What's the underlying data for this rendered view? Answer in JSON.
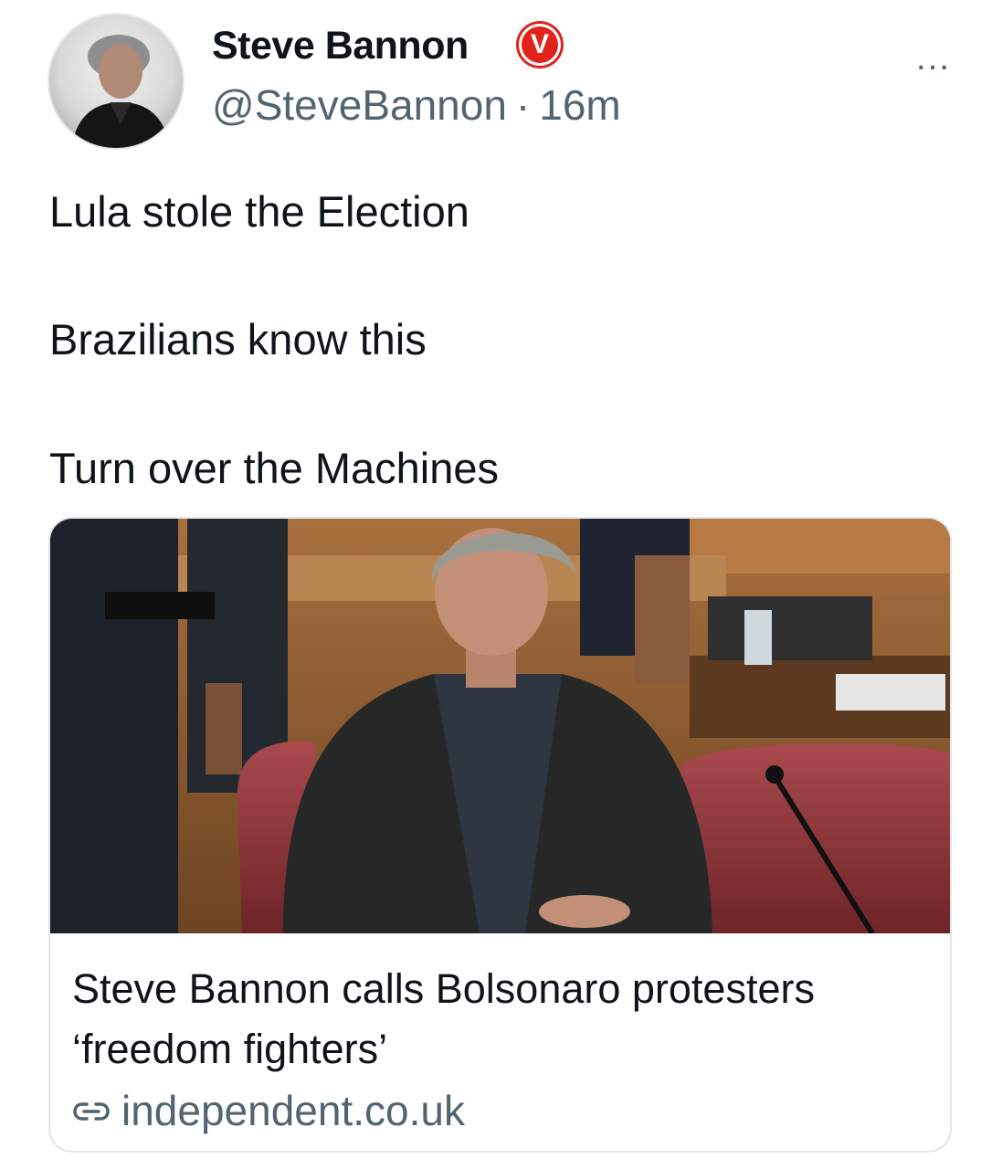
{
  "tweet": {
    "author": {
      "display_name": "Steve Bannon",
      "verified_badge": "V",
      "handle": "@SteveBannon",
      "separator": "·",
      "time": "16m",
      "avatar_icon": "user-avatar"
    },
    "more_label": "…",
    "lines": [
      "Lula stole the Election",
      "Brazilians know this",
      "Turn over the Machines"
    ]
  },
  "link_card": {
    "title": "Steve Bannon calls Bolsonaro protesters ‘freedom fighters’",
    "domain": "independent.co.uk",
    "image_alt_icon": "news-photo",
    "link_icon": "link-icon"
  },
  "colors": {
    "text_primary": "#0f1419",
    "text_secondary": "#536471",
    "badge": "#e0231d",
    "card_border": "#e1e6ea"
  }
}
